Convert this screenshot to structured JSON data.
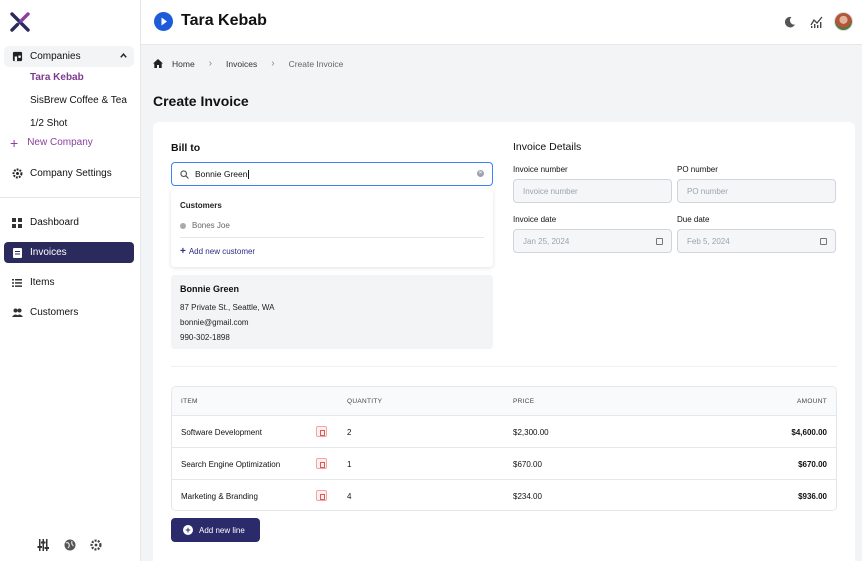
{
  "app": {
    "title": "Tara Kebab"
  },
  "sidebar": {
    "companies_label": "Companies",
    "companies": [
      "Tara Kebab",
      "SisBrew Coffee & Tea",
      "1/2 Shot"
    ],
    "new_company": "New Company",
    "company_settings": "Company Settings",
    "nav": [
      "Dashboard",
      "Invoices",
      "Items",
      "Customers"
    ],
    "active_nav": "Invoices"
  },
  "breadcrumb": [
    "Home",
    "Invoices",
    "Create Invoice"
  ],
  "page_title": "Create Invoice",
  "bill_to": {
    "heading": "Bill to",
    "search_value": "Bonnie Green",
    "dropdown": {
      "heading": "Customers",
      "items": [
        "Bones Joe"
      ],
      "add_label": "Add new customer"
    },
    "customer": {
      "name": "Bonnie Green",
      "address": "87 Private St., Seattle, WA",
      "email": "bonnie@gmail.com",
      "phone": "990-302-1898"
    }
  },
  "invoice_details": {
    "heading": "Invoice Details",
    "invoice_number_label": "Invoice number",
    "invoice_number_placeholder": "Invoice number",
    "po_number_label": "PO number",
    "po_number_placeholder": "PO number",
    "invoice_date_label": "Invoice date",
    "invoice_date_value": "Jan 25, 2024",
    "due_date_label": "Due date",
    "due_date_value": "Feb 5, 2024"
  },
  "line_items": {
    "columns": [
      "ITEM",
      "QUANTITY",
      "PRICE",
      "AMOUNT"
    ],
    "rows": [
      {
        "item": "Software Development",
        "quantity": "2",
        "price": "$2,300.00",
        "amount": "$4,600.00"
      },
      {
        "item": "Search Engine Optimization",
        "quantity": "1",
        "price": "$670.00",
        "amount": "$670.00"
      },
      {
        "item": "Marketing & Branding",
        "quantity": "4",
        "price": "$234.00",
        "amount": "$936.00"
      }
    ],
    "add_line_label": "Add new line"
  },
  "colors": {
    "accent": "#2b2a5c",
    "active_company": "#7e3a8e",
    "brand_icon": "#1d5bd8",
    "search_border": "#3b82f6"
  }
}
